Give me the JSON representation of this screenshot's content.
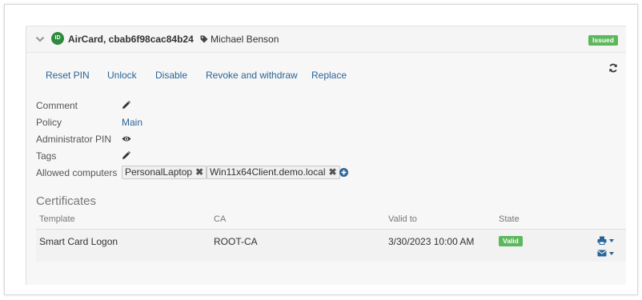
{
  "card": {
    "title": "AirCard, cbab6f98cac84b24",
    "icon_text": "ID",
    "owner": "Michael Benson",
    "status": "Issued",
    "status_color": "#5cb85c",
    "accent_color": "#2a6496"
  },
  "actions": [
    "Reset PIN",
    "Unlock",
    "Disable",
    "Revoke and withdraw",
    "Replace"
  ],
  "properties": {
    "comment_label": "Comment",
    "policy_label": "Policy",
    "policy_value": "Main",
    "admin_pin_label": "Administrator PIN",
    "tags_label": "Tags",
    "allowed_computers_label": "Allowed computers",
    "allowed_computers": [
      "PersonalLaptop",
      "Win11x64Client.demo.local"
    ]
  },
  "certificates": {
    "title": "Certificates",
    "columns": {
      "template": "Template",
      "ca": "CA",
      "valid_to": "Valid to",
      "state": "State"
    },
    "rows": [
      {
        "template": "Smart Card Logon",
        "ca": "ROOT-CA",
        "valid_to": "3/30/2023 10:00 AM",
        "state": "Valid"
      }
    ]
  },
  "icons": [
    "chevron-down-icon",
    "tag-icon",
    "refresh-icon",
    "pencil-icon",
    "eye-icon",
    "remove-icon",
    "plus-circle-icon",
    "print-icon",
    "envelope-icon"
  ]
}
